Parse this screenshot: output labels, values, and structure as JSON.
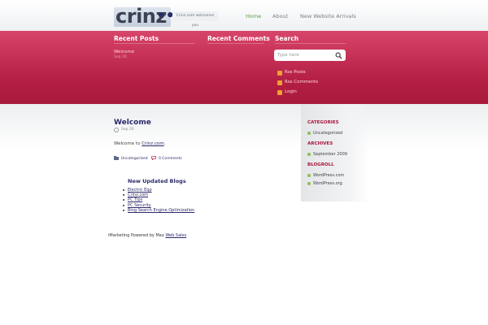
{
  "header": {
    "logo_text": "crinz",
    "logo_dots": "••",
    "tagline": "Crinz.com welcomes you",
    "nav": [
      "Home",
      "About",
      "New Website Arrivals"
    ]
  },
  "band": {
    "recent_posts_title": "Recent Posts",
    "recent_comments_title": "Recent Comments",
    "search_title": "Search",
    "recent_post_link": "Welcome",
    "recent_post_date": "Sep 20",
    "search_placeholder": "Type here",
    "feeds": [
      "Rss Posts",
      "Rss Comments",
      "Login"
    ]
  },
  "post": {
    "title": "Welcome",
    "date": "Sep 20",
    "body_prefix": "Welcome to ",
    "body_link": "Crinz.com",
    "body_suffix": ".",
    "category": "Uncategorized",
    "comments": "0 Comments"
  },
  "blogs": {
    "title": "New Updated Blogs",
    "items": [
      "Electric Eqp",
      "Crinz.com",
      "PC Tips",
      "PC Security",
      "Bing Search Engine Optimization"
    ]
  },
  "footer": {
    "text": "iMarketing Powered by Max ",
    "link": "Web Sales"
  },
  "sidebar": {
    "categories_title": "CATEGORIES",
    "categories": [
      "Uncategorized"
    ],
    "archives_title": "ARCHIVES",
    "archives": [
      "September 2009"
    ],
    "blogroll_title": "BLOGROLL",
    "blogroll": [
      "WordPress.com",
      "WordPress.org"
    ]
  },
  "colors": {
    "accent_red": "#b31e43",
    "link_navy": "#2b2b6b",
    "nav_active": "#5aa04a"
  }
}
